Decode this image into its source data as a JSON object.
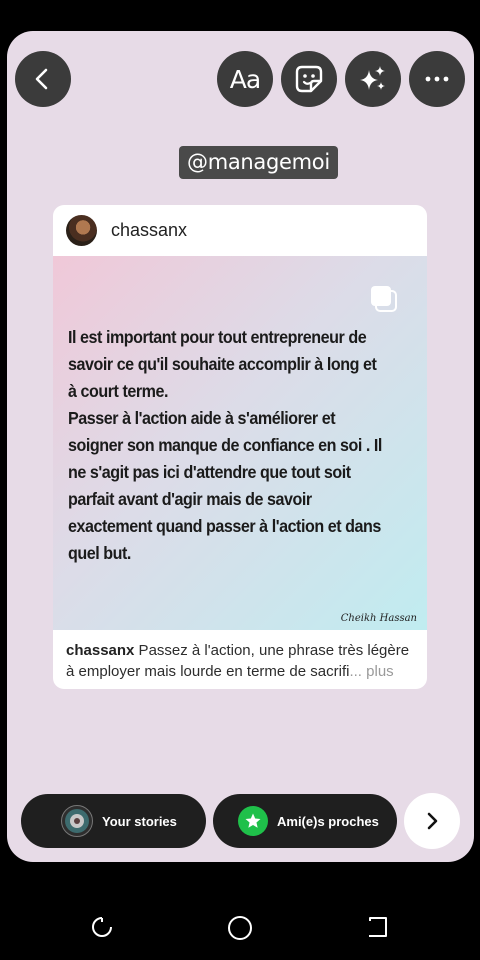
{
  "toolbar": {
    "back_icon": "chevron-left-icon",
    "text_icon_label": "Aa",
    "sticker_icon": "sticker-icon",
    "effects_icon": "sparkles-icon",
    "more_icon": "more-horizontal-icon"
  },
  "mention": {
    "text": "@managemoi"
  },
  "post": {
    "username": "chassanx",
    "image_text": " Il est important pour tout entrepreneur de savoir ce qu'il souhaite accomplir à long et à court terme.\nPasser à l'action aide à s'améliorer et soigner son manque de confiance en soi . Il ne s'agit pas ici d'attendre que tout soit parfait avant d'agir mais de savoir exactement quand passer à l'action et dans quel but.",
    "signature": "Cheikh Hassan",
    "caption_user": "chassanx",
    "caption_text": " Passez à l'action, une phrase très légère à employer mais lourde en terme de sacrifi",
    "caption_more": "... plus"
  },
  "share": {
    "your_stories": "Your stories",
    "close_friends": "Ami(e)s proches",
    "next_icon": "chevron-right-icon"
  },
  "colors": {
    "canvas_bg": "#e7dbe7",
    "button_bg": "#3b3b3b",
    "close_friends_green": "#1fc04a"
  }
}
